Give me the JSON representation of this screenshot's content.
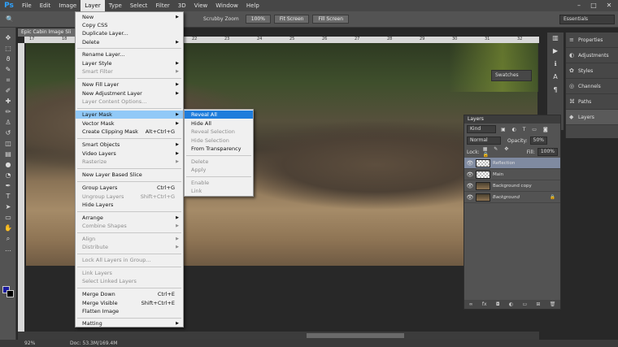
{
  "app": {
    "logo": "Ps"
  },
  "menubar": {
    "items": [
      "File",
      "Edit",
      "Image",
      "Layer",
      "Type",
      "Select",
      "Filter",
      "3D",
      "View",
      "Window",
      "Help"
    ],
    "active": "Layer",
    "window_controls": [
      "–",
      "□",
      "✕"
    ]
  },
  "options_bar": {
    "scrubby_zoom": "Scrubby Zoom",
    "btn_100": "100%",
    "fit_screen": "Fit Screen",
    "fill_screen": "Fill Screen",
    "workspace": "Essentials"
  },
  "document": {
    "tab_title": "Epic Cabin Image Sli",
    "ruler_ticks": [
      "17",
      "18",
      "19",
      "20",
      "21",
      "22",
      "23",
      "24",
      "25",
      "26",
      "27",
      "28",
      "29",
      "30",
      "31",
      "32"
    ]
  },
  "status": {
    "zoom": "92%",
    "doc_info": "Doc: 53.3M/169.4M"
  },
  "layer_menu": {
    "new": "New",
    "copy_css": "Copy CSS",
    "duplicate_layer": "Duplicate Layer...",
    "delete": "Delete",
    "rename_layer": "Rename Layer...",
    "layer_style": "Layer Style",
    "smart_filter": "Smart Filter",
    "new_fill_layer": "New Fill Layer",
    "new_adjustment_layer": "New Adjustment Layer",
    "layer_content_options": "Layer Content Options...",
    "layer_mask": "Layer Mask",
    "vector_mask": "Vector Mask",
    "create_clipping_mask": "Create Clipping Mask",
    "create_clipping_mask_sc": "Alt+Ctrl+G",
    "smart_objects": "Smart Objects",
    "video_layers": "Video Layers",
    "rasterize": "Rasterize",
    "new_layer_based_slice": "New Layer Based Slice",
    "group_layers": "Group Layers",
    "group_layers_sc": "Ctrl+G",
    "ungroup_layers": "Ungroup Layers",
    "ungroup_layers_sc": "Shift+Ctrl+G",
    "hide_layers": "Hide Layers",
    "arrange": "Arrange",
    "combine_shapes": "Combine Shapes",
    "align": "Align",
    "distribute": "Distribute",
    "lock_all_layers": "Lock All Layers in Group...",
    "link_layers": "Link Layers",
    "select_linked_layers": "Select Linked Layers",
    "merge_down": "Merge Down",
    "merge_down_sc": "Ctrl+E",
    "merge_visible": "Merge Visible",
    "merge_visible_sc": "Shift+Ctrl+E",
    "flatten_image": "Flatten Image",
    "matting": "Matting",
    "arrow": "▶"
  },
  "mask_submenu": {
    "reveal_all": "Reveal All",
    "hide_all": "Hide All",
    "reveal_selection": "Reveal Selection",
    "hide_selection": "Hide Selection",
    "from_transparency": "From Transparency",
    "delete": "Delete",
    "apply": "Apply",
    "enable": "Enable",
    "link": "Link"
  },
  "right_dock": {
    "items": [
      {
        "label": "Properties",
        "icon": "properties-icon",
        "glyph": "≡"
      },
      {
        "label": "Adjustments",
        "icon": "adjustments-icon",
        "glyph": "◐"
      },
      {
        "label": "Styles",
        "icon": "styles-icon",
        "glyph": "✿"
      },
      {
        "label": "Channels",
        "icon": "channels-icon",
        "glyph": "◎"
      },
      {
        "label": "Paths",
        "icon": "paths-icon",
        "glyph": "⌘"
      },
      {
        "label": "Layers",
        "icon": "layers-icon",
        "glyph": "◆"
      }
    ],
    "swatches": "Swatches"
  },
  "layers_panel": {
    "tab": "Layers",
    "filter_kind": "Kind",
    "blend_mode": "Normal",
    "opacity_label": "Opacity:",
    "opacity_value": "50%",
    "lock_label": "Lock:",
    "fill_label": "Fill:",
    "fill_value": "100%",
    "layers": [
      {
        "name": "Reflection",
        "thumb": "checker",
        "selected": true
      },
      {
        "name": "Main",
        "thumb": "checker",
        "selected": false
      },
      {
        "name": "Background copy",
        "thumb": "photo",
        "selected": false
      },
      {
        "name": "Background",
        "thumb": "photo",
        "selected": false,
        "locked": true
      }
    ],
    "footer_icons": [
      "∞",
      "fx",
      "◘",
      "◐",
      "▭",
      "⊞",
      "🗑"
    ]
  }
}
